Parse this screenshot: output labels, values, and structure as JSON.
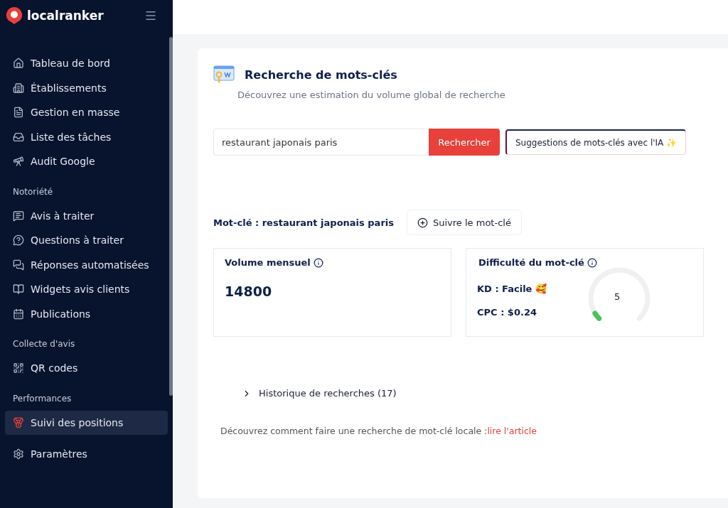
{
  "sidebar": {
    "logo": "localranker",
    "sections": [
      {
        "items": [
          {
            "label": "Tableau de bord",
            "selected": false
          },
          {
            "label": "Établissements",
            "selected": false
          },
          {
            "label": "Gestion en masse",
            "selected": false
          },
          {
            "label": "Liste des tâches",
            "selected": false
          },
          {
            "label": "Audit Google",
            "selected": false
          }
        ]
      },
      {
        "heading": "Notoriété",
        "items": [
          {
            "label": "Avis à traiter",
            "selected": false
          },
          {
            "label": "Questions à traiter",
            "selected": false
          },
          {
            "label": "Réponses automatisées",
            "selected": false
          },
          {
            "label": "Widgets avis clients",
            "selected": false
          },
          {
            "label": "Publications",
            "selected": false
          }
        ]
      },
      {
        "heading": "Collecte d'avis",
        "items": [
          {
            "label": "QR codes",
            "selected": false
          }
        ]
      },
      {
        "heading": "Performances",
        "items": [
          {
            "label": "Suivi des positions",
            "selected": true
          }
        ]
      },
      {
        "items": [
          {
            "label": "Paramètres",
            "selected": false
          }
        ]
      }
    ]
  },
  "page": {
    "title": "Recherche de mots-clés",
    "subtitle": "Découvrez une estimation du volume global de recherche",
    "search": {
      "value": "restaurant japonais paris",
      "button": "Rechercher",
      "ai_button": "Suggestions de mots-clés avec l'IA ✨"
    },
    "keyword_label": "Mot-clé : restaurant japonais paris",
    "follow_button": "Suivre le mot-clé",
    "volume": {
      "title": "Volume mensuel",
      "value": "14800"
    },
    "difficulty": {
      "title": "Difficulté du mot-clé",
      "kd": "KD : Facile 🥰",
      "cpc": "CPC : $0.24",
      "gauge_value": "5",
      "level": 0.05
    },
    "history": {
      "label": "Historique de recherches (17)",
      "expanded": false
    },
    "footer": {
      "text": "Découvrez comment faire une recherche de mot-clé locale :",
      "link": "lire l'article"
    }
  }
}
